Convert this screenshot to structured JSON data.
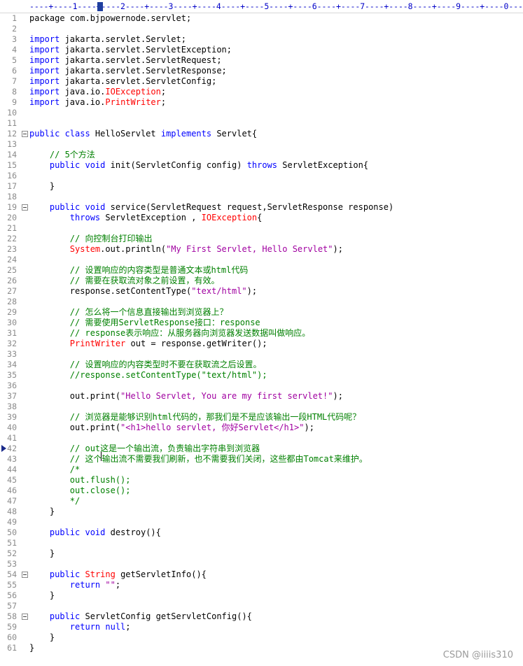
{
  "ruler": {
    "text": "----+----1----+----2----+----3----+----4----+----5----+----6----+----7----+----8----+----9----+----0---"
  },
  "lines": [
    {
      "n": "1",
      "segs": [
        [
          "t",
          "package com.bjpowernode.servlet;"
        ]
      ]
    },
    {
      "n": "2",
      "segs": []
    },
    {
      "n": "3",
      "segs": [
        [
          "kw",
          "import"
        ],
        [
          "t",
          " jakarta.servlet.Servlet;"
        ]
      ]
    },
    {
      "n": "4",
      "segs": [
        [
          "kw",
          "import"
        ],
        [
          "t",
          " jakarta.servlet.ServletException;"
        ]
      ]
    },
    {
      "n": "5",
      "segs": [
        [
          "kw",
          "import"
        ],
        [
          "t",
          " jakarta.servlet.ServletRequest;"
        ]
      ]
    },
    {
      "n": "6",
      "segs": [
        [
          "kw",
          "import"
        ],
        [
          "t",
          " jakarta.servlet.ServletResponse;"
        ]
      ]
    },
    {
      "n": "7",
      "segs": [
        [
          "kw",
          "import"
        ],
        [
          "t",
          " jakarta.servlet.ServletConfig;"
        ]
      ]
    },
    {
      "n": "8",
      "segs": [
        [
          "kw",
          "import"
        ],
        [
          "t",
          " java.io."
        ],
        [
          "cls",
          "IOException"
        ],
        [
          "t",
          ";"
        ]
      ]
    },
    {
      "n": "9",
      "segs": [
        [
          "kw",
          "import"
        ],
        [
          "t",
          " java.io."
        ],
        [
          "cls",
          "PrintWriter"
        ],
        [
          "t",
          ";"
        ]
      ]
    },
    {
      "n": "10",
      "segs": []
    },
    {
      "n": "11",
      "segs": []
    },
    {
      "n": "12",
      "fold": true,
      "segs": [
        [
          "kw",
          "public class"
        ],
        [
          "t",
          " HelloServlet "
        ],
        [
          "kw",
          "implements"
        ],
        [
          "t",
          " Servlet{"
        ]
      ]
    },
    {
      "n": "13",
      "segs": []
    },
    {
      "n": "14",
      "segs": [
        [
          "t",
          "    "
        ],
        [
          "cm",
          "// 5个方法"
        ]
      ]
    },
    {
      "n": "15",
      "segs": [
        [
          "t",
          "    "
        ],
        [
          "kw",
          "public void"
        ],
        [
          "t",
          " init(ServletConfig config) "
        ],
        [
          "kw",
          "throws"
        ],
        [
          "t",
          " ServletException{"
        ]
      ]
    },
    {
      "n": "16",
      "segs": []
    },
    {
      "n": "17",
      "segs": [
        [
          "t",
          "    }"
        ]
      ]
    },
    {
      "n": "18",
      "segs": []
    },
    {
      "n": "19",
      "fold": true,
      "segs": [
        [
          "t",
          "    "
        ],
        [
          "kw",
          "public void"
        ],
        [
          "t",
          " service(ServletRequest request,ServletResponse response)"
        ]
      ]
    },
    {
      "n": "20",
      "segs": [
        [
          "t",
          "        "
        ],
        [
          "kw",
          "throws"
        ],
        [
          "t",
          " ServletException , "
        ],
        [
          "cls",
          "IOException"
        ],
        [
          "t",
          "{"
        ]
      ]
    },
    {
      "n": "21",
      "segs": []
    },
    {
      "n": "22",
      "segs": [
        [
          "t",
          "        "
        ],
        [
          "cm",
          "// 向控制台打印输出"
        ]
      ]
    },
    {
      "n": "23",
      "segs": [
        [
          "t",
          "        "
        ],
        [
          "cls",
          "System"
        ],
        [
          "t",
          ".out.println("
        ],
        [
          "str",
          "\"My First Servlet, Hello Servlet\""
        ],
        [
          "t",
          ");"
        ]
      ]
    },
    {
      "n": "24",
      "segs": []
    },
    {
      "n": "25",
      "segs": [
        [
          "t",
          "        "
        ],
        [
          "cm",
          "// 设置响应的内容类型是普通文本或html代码"
        ]
      ]
    },
    {
      "n": "26",
      "segs": [
        [
          "t",
          "        "
        ],
        [
          "cm",
          "// 需要在获取流对象之前设置，有效。"
        ]
      ]
    },
    {
      "n": "27",
      "segs": [
        [
          "t",
          "        response.setContentType("
        ],
        [
          "str",
          "\"text/html\""
        ],
        [
          "t",
          ");"
        ]
      ]
    },
    {
      "n": "28",
      "segs": []
    },
    {
      "n": "29",
      "segs": [
        [
          "t",
          "        "
        ],
        [
          "cm",
          "// 怎么将一个信息直接输出到浏览器上？"
        ]
      ]
    },
    {
      "n": "30",
      "segs": [
        [
          "t",
          "        "
        ],
        [
          "cm",
          "// 需要使用ServletResponse接口：response"
        ]
      ]
    },
    {
      "n": "31",
      "segs": [
        [
          "t",
          "        "
        ],
        [
          "cm",
          "// response表示响应：从服务器向浏览器发送数据叫做响应。"
        ]
      ]
    },
    {
      "n": "32",
      "segs": [
        [
          "t",
          "        "
        ],
        [
          "cls",
          "PrintWriter"
        ],
        [
          "t",
          " out = response.getWriter();"
        ]
      ]
    },
    {
      "n": "33",
      "segs": []
    },
    {
      "n": "34",
      "segs": [
        [
          "t",
          "        "
        ],
        [
          "cm",
          "// 设置响应的内容类型时不要在获取流之后设置。"
        ]
      ]
    },
    {
      "n": "35",
      "segs": [
        [
          "t",
          "        "
        ],
        [
          "cm",
          "//response.setContentType(\"text/html\");"
        ]
      ]
    },
    {
      "n": "36",
      "segs": []
    },
    {
      "n": "37",
      "segs": [
        [
          "t",
          "        out.print("
        ],
        [
          "str",
          "\"Hello Servlet, You are my first servlet!\""
        ],
        [
          "t",
          ");"
        ]
      ]
    },
    {
      "n": "38",
      "segs": []
    },
    {
      "n": "39",
      "segs": [
        [
          "t",
          "        "
        ],
        [
          "cm",
          "// 浏览器是能够识别html代码的，那我们是不是应该输出一段HTML代码呢？"
        ]
      ]
    },
    {
      "n": "40",
      "segs": [
        [
          "t",
          "        out.print("
        ],
        [
          "str",
          "\"<h1>hello servlet, 你好Servlet</h1>\""
        ],
        [
          "t",
          ");"
        ]
      ]
    },
    {
      "n": "41",
      "segs": []
    },
    {
      "n": "42",
      "mark": true,
      "segs": [
        [
          "t",
          "        "
        ],
        [
          "cm",
          "// out"
        ],
        [
          "cur",
          ""
        ],
        [
          "cm",
          "这是一个输出流，负责输出字符串到浏览器"
        ]
      ]
    },
    {
      "n": "43",
      "segs": [
        [
          "t",
          "        "
        ],
        [
          "cm",
          "// 这个输出流不需要我们刷新，也不需要我们关闭，这些都由Tomcat来维护。"
        ]
      ]
    },
    {
      "n": "44",
      "segs": [
        [
          "t",
          "        "
        ],
        [
          "cm",
          "/*"
        ]
      ]
    },
    {
      "n": "45",
      "segs": [
        [
          "t",
          "        "
        ],
        [
          "cm",
          "out.flush();"
        ]
      ]
    },
    {
      "n": "46",
      "segs": [
        [
          "t",
          "        "
        ],
        [
          "cm",
          "out.close();"
        ]
      ]
    },
    {
      "n": "47",
      "segs": [
        [
          "t",
          "        "
        ],
        [
          "cm",
          "*/"
        ]
      ]
    },
    {
      "n": "48",
      "segs": [
        [
          "t",
          "    }"
        ]
      ]
    },
    {
      "n": "49",
      "segs": []
    },
    {
      "n": "50",
      "segs": [
        [
          "t",
          "    "
        ],
        [
          "kw",
          "public void"
        ],
        [
          "t",
          " destroy(){"
        ]
      ]
    },
    {
      "n": "51",
      "segs": []
    },
    {
      "n": "52",
      "segs": [
        [
          "t",
          "    }"
        ]
      ]
    },
    {
      "n": "53",
      "segs": []
    },
    {
      "n": "54",
      "fold": true,
      "segs": [
        [
          "t",
          "    "
        ],
        [
          "kw",
          "public"
        ],
        [
          "t",
          " "
        ],
        [
          "cls",
          "String"
        ],
        [
          "t",
          " getServletInfo(){"
        ]
      ]
    },
    {
      "n": "55",
      "segs": [
        [
          "t",
          "        "
        ],
        [
          "kw",
          "return"
        ],
        [
          "t",
          " "
        ],
        [
          "str",
          "\"\""
        ],
        [
          "t",
          ";"
        ]
      ]
    },
    {
      "n": "56",
      "segs": [
        [
          "t",
          "    }"
        ]
      ]
    },
    {
      "n": "57",
      "segs": []
    },
    {
      "n": "58",
      "fold": true,
      "segs": [
        [
          "t",
          "    "
        ],
        [
          "kw",
          "public"
        ],
        [
          "t",
          " ServletConfig getServletConfig(){"
        ]
      ]
    },
    {
      "n": "59",
      "segs": [
        [
          "t",
          "        "
        ],
        [
          "kw",
          "return null"
        ],
        [
          "t",
          ";"
        ]
      ]
    },
    {
      "n": "60",
      "segs": [
        [
          "t",
          "    }"
        ]
      ]
    },
    {
      "n": "61",
      "segs": [
        [
          "t",
          "}"
        ]
      ]
    }
  ],
  "watermark": "CSDN @iiiis310"
}
